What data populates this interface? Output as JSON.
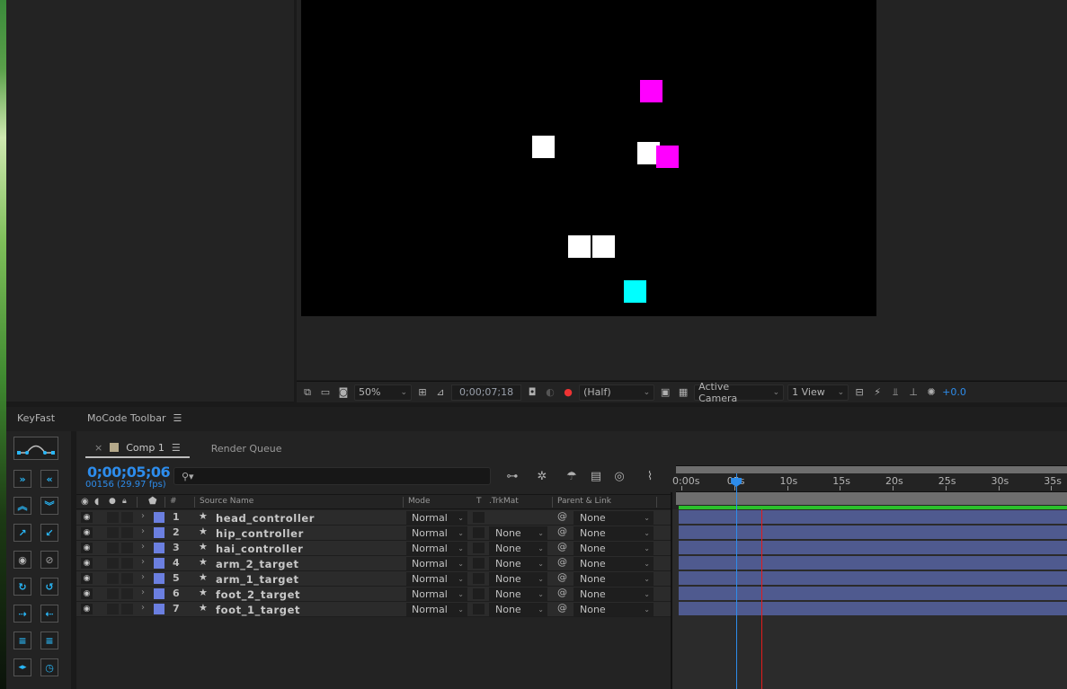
{
  "viewer": {
    "canvas_background": "#000000",
    "shapes": [
      {
        "name": "magenta-square-top",
        "color": "#ff00ff"
      },
      {
        "name": "white-square-left",
        "color": "#ffffff"
      },
      {
        "name": "white-square-mid",
        "color": "#ffffff"
      },
      {
        "name": "magenta-square-mid",
        "color": "#ff00ff"
      },
      {
        "name": "white-square-bottom-left",
        "color": "#ffffff"
      },
      {
        "name": "white-square-bottom-right",
        "color": "#ffffff"
      },
      {
        "name": "cyan-square",
        "color": "#00ffff"
      }
    ],
    "toolbar": {
      "zoom": "50%",
      "timecode": "0;00;07;18",
      "resolution": "(Half)",
      "camera": "Active Camera",
      "views": "1 View",
      "exposure": "+0.0"
    }
  },
  "panels": {
    "keyfast": "KeyFast",
    "mocode": "MoCode Toolbar",
    "menu_icon": "☰"
  },
  "keyfast_buttons": [
    {
      "name": "ease-curve",
      "glyph": ""
    },
    {
      "name": "next-key",
      "glyph": "»"
    },
    {
      "name": "prev-key",
      "glyph": "«"
    },
    {
      "name": "move-up",
      "glyph": "︽"
    },
    {
      "name": "move-down",
      "glyph": "︾"
    },
    {
      "name": "export-out",
      "glyph": "↗"
    },
    {
      "name": "import-in",
      "glyph": "↙"
    },
    {
      "name": "show",
      "glyph": "◉"
    },
    {
      "name": "hide",
      "glyph": "⊘"
    },
    {
      "name": "rotate-cw",
      "glyph": "↻"
    },
    {
      "name": "rotate-ccw",
      "glyph": "↺"
    },
    {
      "name": "shift-right",
      "glyph": "⇢"
    },
    {
      "name": "shift-left",
      "glyph": "⇠"
    },
    {
      "name": "align-right",
      "glyph": "≡"
    },
    {
      "name": "align-left",
      "glyph": "≡"
    },
    {
      "name": "mirror",
      "glyph": "◂▸"
    },
    {
      "name": "clock",
      "glyph": "◷"
    }
  ],
  "timeline": {
    "close": "×",
    "comp_tab": "Comp 1",
    "comp_color": "#b5a98a",
    "render_queue_tab": "Render Queue",
    "current_time": "0;00;05;06",
    "frame_info": "00156 (29.97 fps)",
    "search_placeholder": "",
    "columns": {
      "hash": "#",
      "source_name": "Source Name",
      "mode": "Mode",
      "t": "T",
      "trkmat": ".TrkMat",
      "parent": "Parent & Link"
    },
    "ruler_labels": [
      "0:00s",
      "05s",
      "10s",
      "15s",
      "20s",
      "25s",
      "30s",
      "35s"
    ],
    "current_time_seconds": 5.2,
    "marker_seconds": 7.6,
    "layers": [
      {
        "num": "1",
        "name": "head_controller",
        "mode": "Normal",
        "trkmat": "",
        "parent": "None",
        "label_color": "#6b7fe0"
      },
      {
        "num": "2",
        "name": "hip_controller",
        "mode": "Normal",
        "trkmat": "None",
        "parent": "None",
        "label_color": "#6b7fe0"
      },
      {
        "num": "3",
        "name": "hai_controller",
        "mode": "Normal",
        "trkmat": "None",
        "parent": "None",
        "label_color": "#6b7fe0"
      },
      {
        "num": "4",
        "name": "arm_2_target",
        "mode": "Normal",
        "trkmat": "None",
        "parent": "None",
        "label_color": "#6b7fe0"
      },
      {
        "num": "5",
        "name": "arm_1_target",
        "mode": "Normal",
        "trkmat": "None",
        "parent": "None",
        "label_color": "#6b7fe0"
      },
      {
        "num": "6",
        "name": "foot_2_target",
        "mode": "Normal",
        "trkmat": "None",
        "parent": "None",
        "label_color": "#6b7fe0"
      },
      {
        "num": "7",
        "name": "foot_1_target",
        "mode": "Normal",
        "trkmat": "None",
        "parent": "None",
        "label_color": "#6b7fe0"
      }
    ]
  }
}
